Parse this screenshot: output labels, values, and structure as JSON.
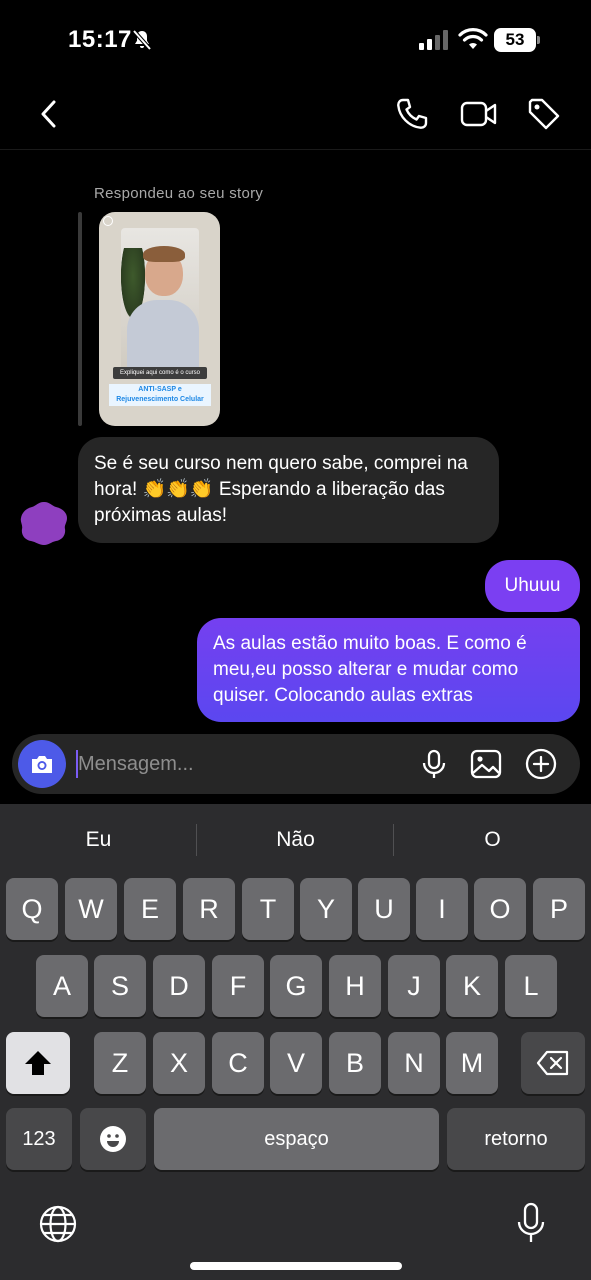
{
  "status": {
    "time": "15:17",
    "battery": "53"
  },
  "chat": {
    "reply_label": "Respondeu ao seu story",
    "story": {
      "caption": "Expliquei aqui como é o curso",
      "title_line1": "ANTI-SASP e",
      "title_line2": "Rejuvenescimento Celular"
    },
    "incoming_message": "Se é seu curso nem quero sabe, comprei na hora! 👏👏👏 Esperando a liberação das próximas aulas!",
    "outgoing_messages": [
      "Uhuuu",
      "As aulas estão muito boas. E como é meu,eu posso alterar e mudar como quiser. Colocando aulas extras"
    ],
    "colors": {
      "outgoing_bubble": "#7b3ff2",
      "incoming_bubble": "#262626",
      "camera_button": "#4d5ae8"
    }
  },
  "composer": {
    "placeholder": "Mensagem...",
    "icons": [
      "camera-icon",
      "microphone-icon",
      "gallery-icon",
      "plus-circle-icon"
    ]
  },
  "keyboard": {
    "suggestions": [
      "Eu",
      "Não",
      "O"
    ],
    "row1": [
      "Q",
      "W",
      "E",
      "R",
      "T",
      "Y",
      "U",
      "I",
      "O",
      "P"
    ],
    "row2": [
      "A",
      "S",
      "D",
      "F",
      "G",
      "H",
      "J",
      "K",
      "L"
    ],
    "row3": [
      "Z",
      "X",
      "C",
      "V",
      "B",
      "N",
      "M"
    ],
    "numbers_label": "123",
    "space_label": "espaço",
    "return_label": "retorno"
  }
}
